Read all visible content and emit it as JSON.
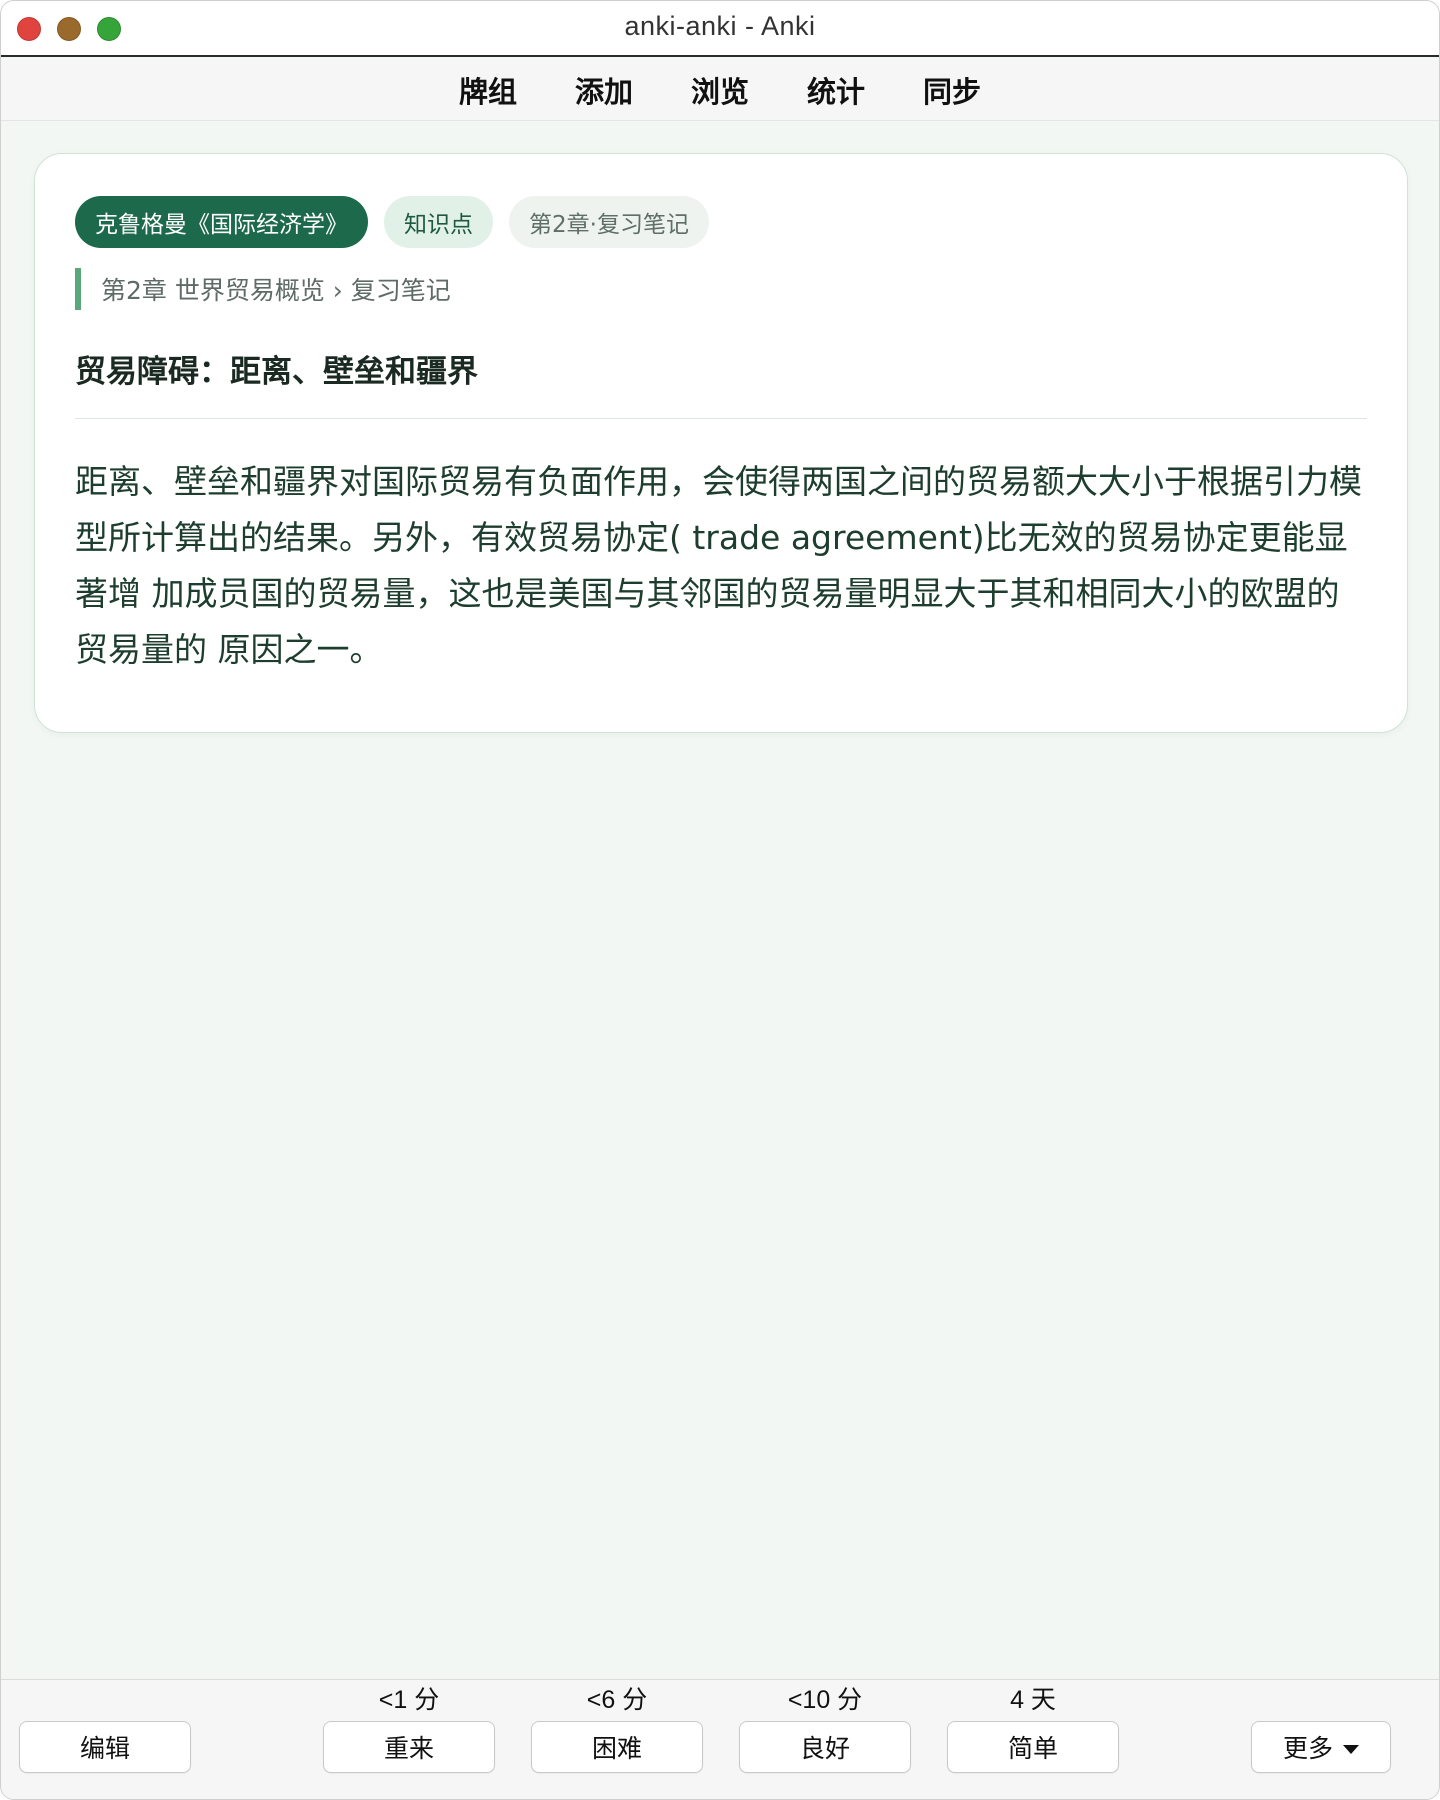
{
  "window": {
    "title": "anki-anki - Anki"
  },
  "topnav": {
    "items": [
      "牌组",
      "添加",
      "浏览",
      "统计",
      "同步"
    ]
  },
  "card": {
    "tags": [
      {
        "label": "克鲁格曼《国际经济学》",
        "style": "primary"
      },
      {
        "label": "知识点",
        "style": "soft"
      },
      {
        "label": "第2章·复习笔记",
        "style": "muted"
      }
    ],
    "breadcrumb": "第2章 世界贸易概览 › 复习笔记",
    "title": "贸易障碍：距离、壁垒和疆界",
    "content": "距离、壁垒和疆界对国际贸易有负面作用，会使得两国之间的贸易额大大小于根据引力模型所计算出的结果。另外，有效贸易协定( trade agreement)比无效的贸易协定更能显著增 加成员国的贸易量，这也是美国与其邻国的贸易量明显大于其和相同大小的欧盟的贸易量的 原因之一。"
  },
  "bottombar": {
    "edit_label": "编辑",
    "answers": [
      {
        "label": "重来",
        "interval": "<1 分"
      },
      {
        "label": "困难",
        "interval": "<6 分"
      },
      {
        "label": "良好",
        "interval": "<10 分"
      },
      {
        "label": "简单",
        "interval": "4 天"
      }
    ],
    "more_label": "更多"
  },
  "colors": {
    "accent": "#1c6a4b",
    "tag_soft_bg": "#e1f1e7",
    "breadcrumb_bar": "#5aa77c",
    "background": "#f3f7f4",
    "close": "#e0443e",
    "minimize": "#9a6a2c",
    "maximize": "#35a53a"
  }
}
